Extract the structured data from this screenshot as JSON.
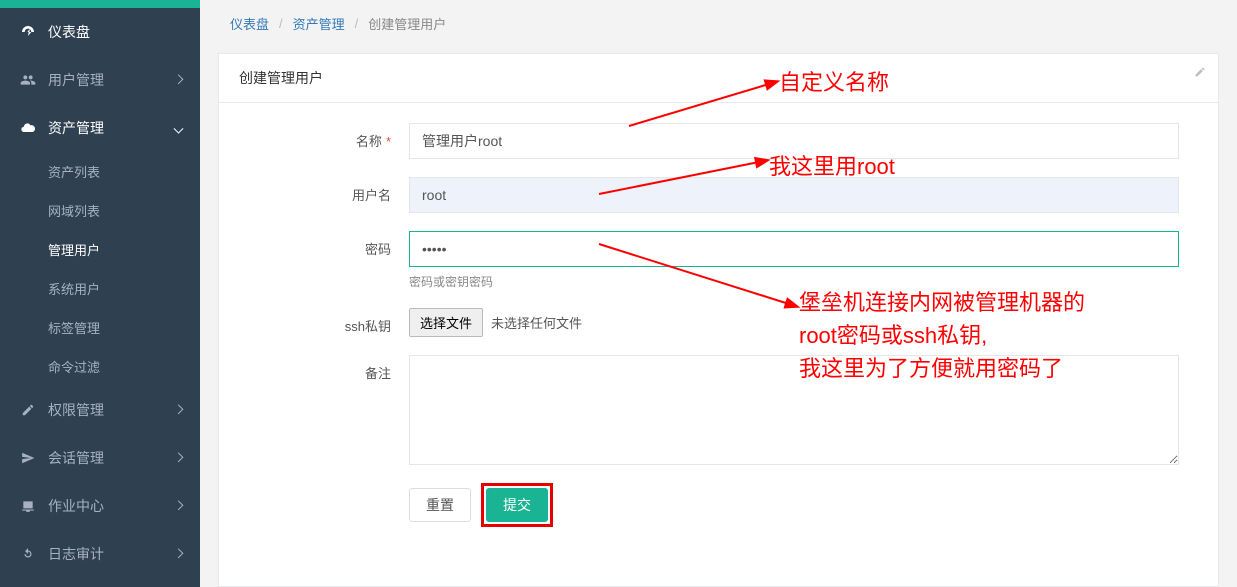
{
  "sidebar": {
    "items": [
      {
        "label": "仪表盘",
        "icon": "dashboard-icon"
      },
      {
        "label": "用户管理",
        "icon": "users-icon"
      },
      {
        "label": "资产管理",
        "icon": "cloud-icon",
        "children": [
          {
            "label": "资产列表"
          },
          {
            "label": "网域列表"
          },
          {
            "label": "管理用户"
          },
          {
            "label": "系统用户"
          },
          {
            "label": "标签管理"
          },
          {
            "label": "命令过滤"
          }
        ]
      },
      {
        "label": "权限管理",
        "icon": "edit-icon"
      },
      {
        "label": "会话管理",
        "icon": "send-icon"
      },
      {
        "label": "作业中心",
        "icon": "monitor-icon"
      },
      {
        "label": "日志审计",
        "icon": "refresh-icon"
      }
    ]
  },
  "breadcrumb": {
    "items": [
      "仪表盘",
      "资产管理",
      "创建管理用户"
    ]
  },
  "panel": {
    "title": "创建管理用户"
  },
  "form": {
    "name_label": "名称",
    "name_value": "管理用户root",
    "username_label": "用户名",
    "username_value": "root",
    "password_label": "密码",
    "password_value": "•••••",
    "password_help": "密码或密钥密码",
    "sshkey_label": "ssh私钥",
    "file_button": "选择文件",
    "file_status": "未选择任何文件",
    "comment_label": "备注",
    "comment_value": "",
    "reset_label": "重置",
    "submit_label": "提交"
  },
  "annotations": {
    "a1": "自定义名称",
    "a2": "我这里用root",
    "a3_line1": "堡垒机连接内网被管理机器的",
    "a3_line2": "root密码或ssh私钥,",
    "a3_line3": "我这里为了方便就用密码了"
  }
}
